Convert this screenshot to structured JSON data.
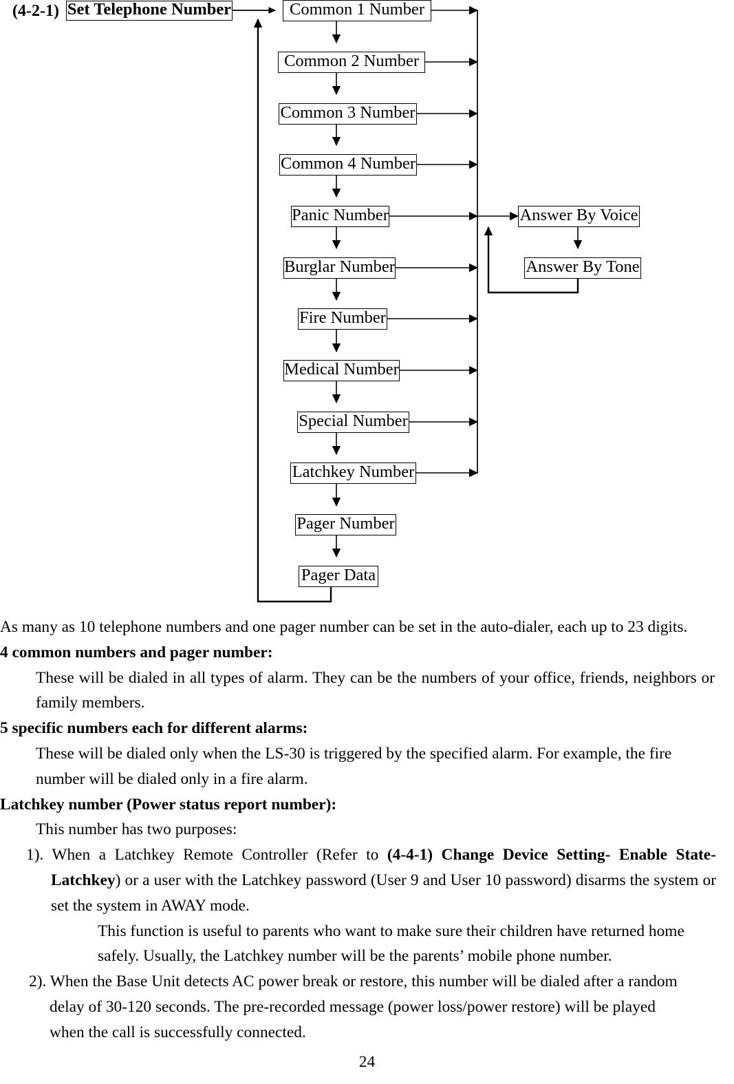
{
  "document": {
    "page_number": "24",
    "section_label": "(4-2-1)"
  },
  "flowchart": {
    "root": {
      "label": "Set Telephone Number"
    },
    "main_chain": [
      {
        "label": "Common 1 Number"
      },
      {
        "label": "Common 2 Number"
      },
      {
        "label": "Common 3 Number"
      },
      {
        "label": "Common 4 Number"
      },
      {
        "label": "Panic Number"
      },
      {
        "label": "Burglar Number"
      },
      {
        "label": "Fire Number"
      },
      {
        "label": "Medical Number"
      },
      {
        "label": "Special Number"
      },
      {
        "label": "Latchkey Number"
      },
      {
        "label": "Pager Number"
      },
      {
        "label": "Pager Data"
      }
    ],
    "answer_branch": [
      {
        "label": "Answer By Voice"
      },
      {
        "label": "Answer By Tone"
      }
    ]
  },
  "body": {
    "intro": "As many as 10 telephone numbers and one pager number can be set in the auto-dialer, each up to 23 digits.",
    "heading_common": "4 common numbers and pager number:",
    "common_desc": "These will be dialed in all types of alarm. They can be the numbers of your office, friends, neighbors or family members.",
    "heading_specific": "5 specific numbers each for different alarms:",
    "specific_desc": "These will be dialed only when the LS-30 is triggered by the specified alarm. For example, the fire number will be dialed only in a fire alarm.",
    "heading_latchkey": "Latchkey number (Power status report number):",
    "latchkey_intro": "This number has two purposes:",
    "item1_marker": "1).",
    "item1_part1": "When a Latchkey Remote Controller (Refer to ",
    "item1_bold1": "(4-4-1) Change Device Setting- Enable State- Latchkey",
    "item1_part2": ") or a user with the Latchkey password (User 9 and User 10 password) disarms the system or set the system in AWAY mode.",
    "item1_extra": "This function is useful to parents who want to make sure their children have returned home safely. Usually, the Latchkey number will be the parents’ mobile phone number.",
    "item2_marker": "2).",
    "item2_text": "When the Base Unit detects AC power break or restore, this number will be dialed after a random delay of 30-120 seconds. The pre-recorded message (power loss/power restore) will be played when the call is successfully connected."
  }
}
